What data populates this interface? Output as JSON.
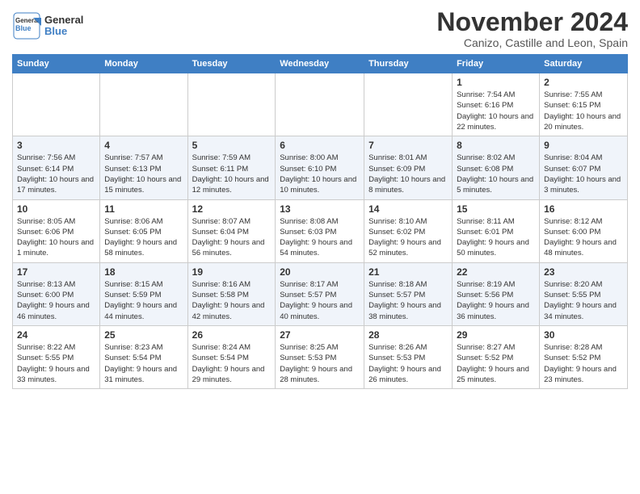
{
  "logo": {
    "text_general": "General",
    "text_blue": "Blue"
  },
  "header": {
    "month": "November 2024",
    "location": "Canizo, Castille and Leon, Spain"
  },
  "weekdays": [
    "Sunday",
    "Monday",
    "Tuesday",
    "Wednesday",
    "Thursday",
    "Friday",
    "Saturday"
  ],
  "weeks": [
    [
      {
        "day": "",
        "info": ""
      },
      {
        "day": "",
        "info": ""
      },
      {
        "day": "",
        "info": ""
      },
      {
        "day": "",
        "info": ""
      },
      {
        "day": "",
        "info": ""
      },
      {
        "day": "1",
        "info": "Sunrise: 7:54 AM\nSunset: 6:16 PM\nDaylight: 10 hours and 22 minutes."
      },
      {
        "day": "2",
        "info": "Sunrise: 7:55 AM\nSunset: 6:15 PM\nDaylight: 10 hours and 20 minutes."
      }
    ],
    [
      {
        "day": "3",
        "info": "Sunrise: 7:56 AM\nSunset: 6:14 PM\nDaylight: 10 hours and 17 minutes."
      },
      {
        "day": "4",
        "info": "Sunrise: 7:57 AM\nSunset: 6:13 PM\nDaylight: 10 hours and 15 minutes."
      },
      {
        "day": "5",
        "info": "Sunrise: 7:59 AM\nSunset: 6:11 PM\nDaylight: 10 hours and 12 minutes."
      },
      {
        "day": "6",
        "info": "Sunrise: 8:00 AM\nSunset: 6:10 PM\nDaylight: 10 hours and 10 minutes."
      },
      {
        "day": "7",
        "info": "Sunrise: 8:01 AM\nSunset: 6:09 PM\nDaylight: 10 hours and 8 minutes."
      },
      {
        "day": "8",
        "info": "Sunrise: 8:02 AM\nSunset: 6:08 PM\nDaylight: 10 hours and 5 minutes."
      },
      {
        "day": "9",
        "info": "Sunrise: 8:04 AM\nSunset: 6:07 PM\nDaylight: 10 hours and 3 minutes."
      }
    ],
    [
      {
        "day": "10",
        "info": "Sunrise: 8:05 AM\nSunset: 6:06 PM\nDaylight: 10 hours and 1 minute."
      },
      {
        "day": "11",
        "info": "Sunrise: 8:06 AM\nSunset: 6:05 PM\nDaylight: 9 hours and 58 minutes."
      },
      {
        "day": "12",
        "info": "Sunrise: 8:07 AM\nSunset: 6:04 PM\nDaylight: 9 hours and 56 minutes."
      },
      {
        "day": "13",
        "info": "Sunrise: 8:08 AM\nSunset: 6:03 PM\nDaylight: 9 hours and 54 minutes."
      },
      {
        "day": "14",
        "info": "Sunrise: 8:10 AM\nSunset: 6:02 PM\nDaylight: 9 hours and 52 minutes."
      },
      {
        "day": "15",
        "info": "Sunrise: 8:11 AM\nSunset: 6:01 PM\nDaylight: 9 hours and 50 minutes."
      },
      {
        "day": "16",
        "info": "Sunrise: 8:12 AM\nSunset: 6:00 PM\nDaylight: 9 hours and 48 minutes."
      }
    ],
    [
      {
        "day": "17",
        "info": "Sunrise: 8:13 AM\nSunset: 6:00 PM\nDaylight: 9 hours and 46 minutes."
      },
      {
        "day": "18",
        "info": "Sunrise: 8:15 AM\nSunset: 5:59 PM\nDaylight: 9 hours and 44 minutes."
      },
      {
        "day": "19",
        "info": "Sunrise: 8:16 AM\nSunset: 5:58 PM\nDaylight: 9 hours and 42 minutes."
      },
      {
        "day": "20",
        "info": "Sunrise: 8:17 AM\nSunset: 5:57 PM\nDaylight: 9 hours and 40 minutes."
      },
      {
        "day": "21",
        "info": "Sunrise: 8:18 AM\nSunset: 5:57 PM\nDaylight: 9 hours and 38 minutes."
      },
      {
        "day": "22",
        "info": "Sunrise: 8:19 AM\nSunset: 5:56 PM\nDaylight: 9 hours and 36 minutes."
      },
      {
        "day": "23",
        "info": "Sunrise: 8:20 AM\nSunset: 5:55 PM\nDaylight: 9 hours and 34 minutes."
      }
    ],
    [
      {
        "day": "24",
        "info": "Sunrise: 8:22 AM\nSunset: 5:55 PM\nDaylight: 9 hours and 33 minutes."
      },
      {
        "day": "25",
        "info": "Sunrise: 8:23 AM\nSunset: 5:54 PM\nDaylight: 9 hours and 31 minutes."
      },
      {
        "day": "26",
        "info": "Sunrise: 8:24 AM\nSunset: 5:54 PM\nDaylight: 9 hours and 29 minutes."
      },
      {
        "day": "27",
        "info": "Sunrise: 8:25 AM\nSunset: 5:53 PM\nDaylight: 9 hours and 28 minutes."
      },
      {
        "day": "28",
        "info": "Sunrise: 8:26 AM\nSunset: 5:53 PM\nDaylight: 9 hours and 26 minutes."
      },
      {
        "day": "29",
        "info": "Sunrise: 8:27 AM\nSunset: 5:52 PM\nDaylight: 9 hours and 25 minutes."
      },
      {
        "day": "30",
        "info": "Sunrise: 8:28 AM\nSunset: 5:52 PM\nDaylight: 9 hours and 23 minutes."
      }
    ]
  ]
}
